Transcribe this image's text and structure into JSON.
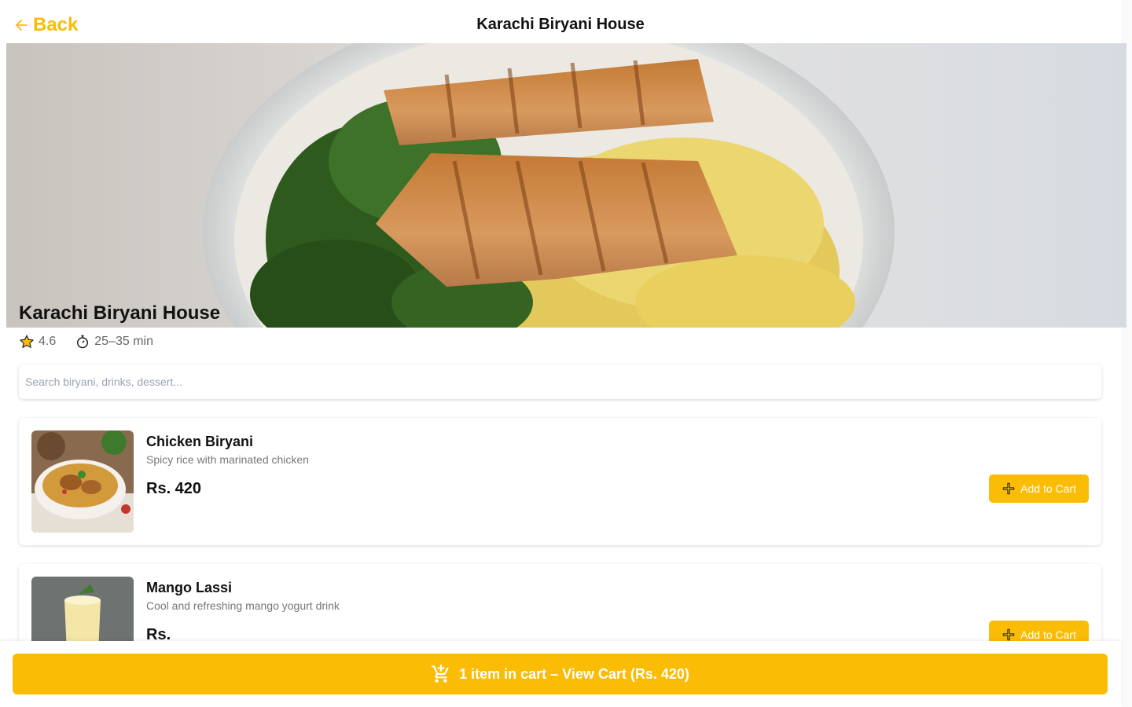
{
  "header": {
    "back_label": "Back",
    "title": "Karachi Biryani House"
  },
  "hero": {
    "restaurant_name": "Karachi Biryani House",
    "image": "grilled-chicken-rice-bowl"
  },
  "meta": {
    "rating": "4.6",
    "delivery_time": "25–35 min"
  },
  "search": {
    "placeholder": "Search biryani, drinks, dessert...",
    "value": ""
  },
  "menu": {
    "items": [
      {
        "name": "Chicken Biryani",
        "description": "Spicy rice with marinated chicken",
        "price": "Rs. 420",
        "image": "chicken-biryani-plate",
        "add_label": "Add to Cart"
      },
      {
        "name": "Mango Lassi",
        "description": "Cool and refreshing mango yogurt drink",
        "price": "Rs.",
        "image": "mango-lassi-glass",
        "add_label": "Add to Cart"
      }
    ]
  },
  "cart": {
    "label": "1 item in cart – View Cart (Rs. 420)"
  },
  "colors": {
    "accent": "#FBBC05",
    "text": "#111111",
    "muted": "#777777",
    "placeholder": "#9aa3b2"
  },
  "icons": {
    "back": "arrow-left-icon",
    "rating": "star-icon",
    "time": "stopwatch-icon",
    "add": "plus-icon",
    "cart": "cart-add-icon"
  }
}
